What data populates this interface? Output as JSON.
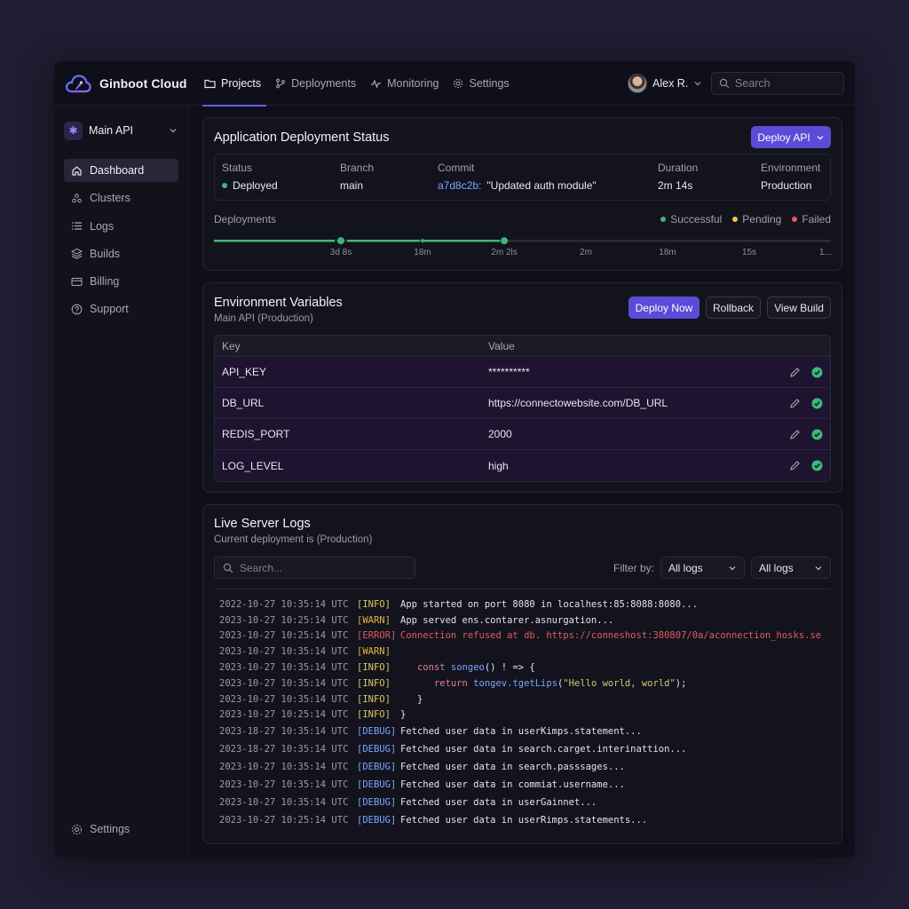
{
  "app": {
    "name": "Ginboot Cloud"
  },
  "nav": {
    "tabs": [
      {
        "label": "Projects",
        "icon": "folder-icon"
      },
      {
        "label": "Deployments",
        "icon": "branch-icon"
      },
      {
        "label": "Monitoring",
        "icon": "pulse-icon"
      },
      {
        "label": "Settings",
        "icon": "gear-icon"
      }
    ]
  },
  "user": {
    "name": "Alex R."
  },
  "search": {
    "placeholder": "Search"
  },
  "sidebar": {
    "project": "Main API",
    "items": [
      {
        "label": "Dashboard",
        "icon": "home-icon"
      },
      {
        "label": "Clusters",
        "icon": "cluster-icon"
      },
      {
        "label": "Logs",
        "icon": "list-icon"
      },
      {
        "label": "Builds",
        "icon": "layers-icon"
      },
      {
        "label": "Billing",
        "icon": "card-icon"
      },
      {
        "label": "Support",
        "icon": "help-icon"
      }
    ],
    "settings": "Settings"
  },
  "deployment": {
    "title": "Application Deployment Status",
    "deploy_button": "Deploy API",
    "status": {
      "label": "Status",
      "value": "Deployed"
    },
    "branch": {
      "label": "Branch",
      "value": "main"
    },
    "commit": {
      "label": "Commit",
      "hash": "a7d8c2b:",
      "message": "\"Updated auth module\""
    },
    "duration": {
      "label": "Duration",
      "value": "2m 14s"
    },
    "environment": {
      "label": "Environment",
      "value": "Production"
    },
    "deployments_label": "Deployments",
    "legend": {
      "successful": "Successful",
      "pending": "Pending",
      "failed": "Failed"
    },
    "ticks": [
      "3d 8s",
      "18m",
      "2m 2ls",
      "2m",
      "18m",
      "15s",
      "1..."
    ]
  },
  "env": {
    "title": "Environment Variables",
    "subtitle": "Main API (Production)",
    "buttons": {
      "deploy_now": "Deploy Now",
      "rollback": "Rollback",
      "view_build": "View Build"
    },
    "columns": {
      "key": "Key",
      "value": "Value"
    },
    "rows": [
      {
        "key": "API_KEY",
        "value": "**********"
      },
      {
        "key": "DB_URL",
        "value": "https://connectowebsite.com/DB_URL"
      },
      {
        "key": "REDIS_PORT",
        "value": "2000"
      },
      {
        "key": "LOG_LEVEL",
        "value": "high"
      }
    ]
  },
  "logs": {
    "title": "Live Server Logs",
    "subtitle": "Current deployment is (Production)",
    "search_placeholder": "Search...",
    "filter_label": "Filter by:",
    "filter_1": "All logs",
    "filter_2": "All logs",
    "lines": [
      {
        "ts": "2022-10-27 10:35:14 UTC",
        "level": "[INFO]",
        "msg": "App started on port 8080 in localhest:85:8088:8080..."
      },
      {
        "ts": "2023-10-27 10:25:14 UTC",
        "level": "[WARN]",
        "msg": "App served ens.contarer.asnurgation..."
      },
      {
        "ts": "2023-10-27 10:25:14 UTC",
        "level": "[ERROR]",
        "msg": "Connection refused at db. https://conneshost:380807/0a/aconnection_hosks.se"
      },
      {
        "ts": "2023-10-27 10:35:14 UTC",
        "level": "[WARN]",
        "msg": ""
      },
      {
        "ts": "2023-10-27 10:35:14 UTC",
        "level": "[INFO]",
        "code": {
          "indent": "   ",
          "kw": "const",
          "fn": "songeo",
          "rest": "() ! => {"
        }
      },
      {
        "ts": "2023-10-27 10:35:14 UTC",
        "level": "[INFO]",
        "code": {
          "indent": "      ",
          "kw": "return",
          "fn": "tongev.tgetLips",
          "rest": "(",
          "str": "\"Hello world, world\"",
          "tail": ");"
        }
      },
      {
        "ts": "2023-10-27 10:35:14 UTC",
        "level": "[INFO]",
        "msg": "   }"
      },
      {
        "ts": "2023-10-27 10:25:14 UTC",
        "level": "[INFO]",
        "msg": "}"
      },
      {
        "ts": "2023-18-27 10:35:14 UTC",
        "level": "[DEBUG]",
        "msg": "Fetched user data in userKimps.statement..."
      },
      {
        "ts": "2023-18-27 10:35:14 UTC",
        "level": "[DEBUG]",
        "msg": "Fetched user data in search.carget.interinattion..."
      },
      {
        "ts": "2023-10-27 10:35:14 UTC",
        "level": "[DEBUG]",
        "msg": "Fetched user data in search.passsages..."
      },
      {
        "ts": "2023-10-27 10:35:14 UTC",
        "level": "[DEBUG]",
        "msg": "Fetched user data in commiat.username..."
      },
      {
        "ts": "2023-10-27 10:35:14 UTC",
        "level": "[DEBUG]",
        "msg": "Fetched user data in userGainnet..."
      },
      {
        "ts": "2023-10-27 10:25:14 UTC",
        "level": "[DEBUG]",
        "msg": "Fetched user data in userRimps.statements..."
      }
    ]
  },
  "colors": {
    "accent": "#5b4bd6",
    "success": "#3cb878",
    "pending": "#f2c04e",
    "failed": "#e05d5d"
  }
}
